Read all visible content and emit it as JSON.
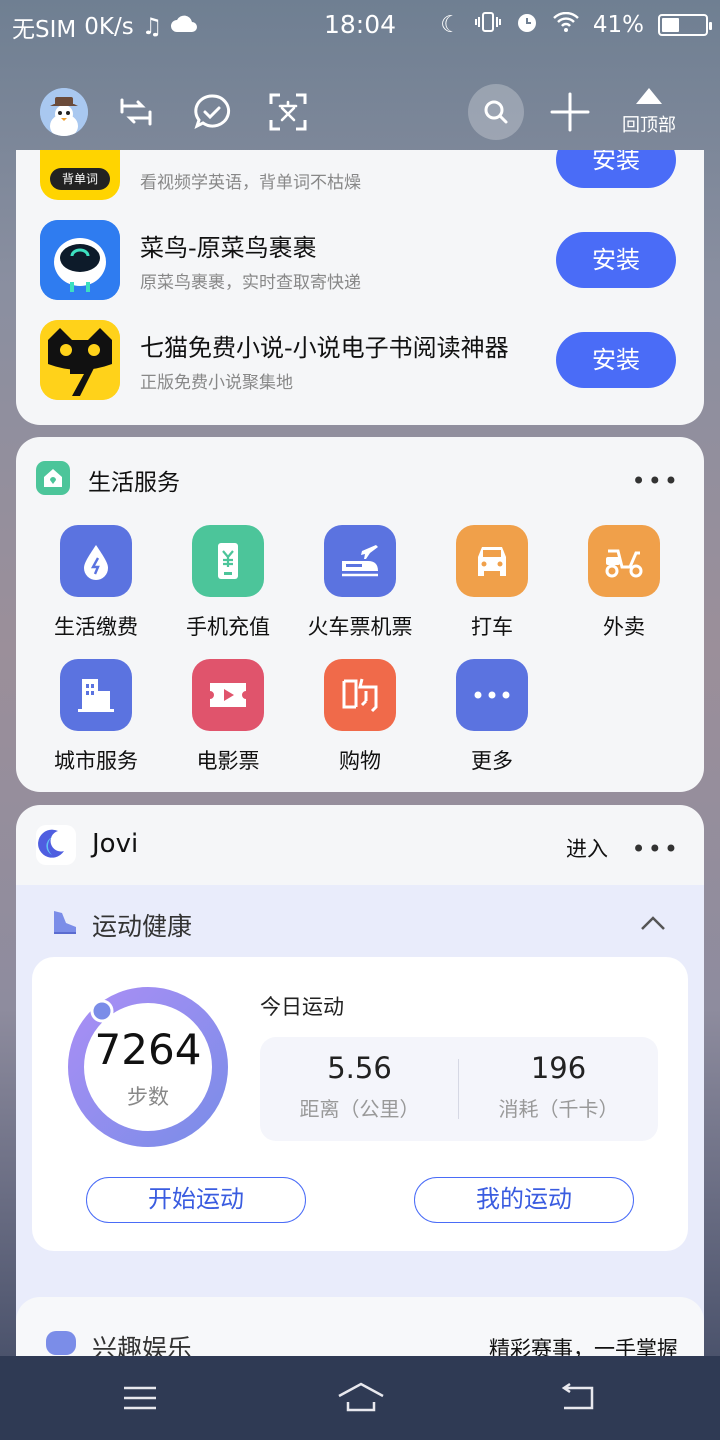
{
  "status_bar": {
    "carrier": "无SIM",
    "net_speed": "0K/s",
    "time": "18:04",
    "battery_percent": "41%",
    "battery_level": 0.41
  },
  "toolbar": {
    "back_to_top_label": "回顶部"
  },
  "apps": [
    {
      "title": "",
      "subtitle": "看视频学英语，背单词不枯燥",
      "badge": "背单词",
      "install": "安装"
    },
    {
      "title": "菜鸟-原菜鸟裹裹",
      "subtitle": "原菜鸟裹裹，实时查取寄快递",
      "install": "安装"
    },
    {
      "title": "七猫免费小说-小说电子书阅读神器",
      "subtitle": "正版免费小说聚集地",
      "install": "安装"
    }
  ],
  "life_services": {
    "title": "生活服务",
    "items": [
      {
        "label": "生活缴费",
        "icon": "water-drop-icon",
        "color": "#5b73e0"
      },
      {
        "label": "手机充值",
        "icon": "phone-yuan-icon",
        "color": "#4cc59a"
      },
      {
        "label": "火车票机票",
        "icon": "train-plane-icon",
        "color": "#5b73e0"
      },
      {
        "label": "打车",
        "icon": "car-icon",
        "color": "#f0a04a"
      },
      {
        "label": "外卖",
        "icon": "scooter-icon",
        "color": "#f0a04a"
      },
      {
        "label": "城市服务",
        "icon": "city-icon",
        "color": "#5b73e0"
      },
      {
        "label": "电影票",
        "icon": "ticket-icon",
        "color": "#e0546c"
      },
      {
        "label": "购物",
        "icon": "shopping-icon",
        "color": "#f06a4a"
      },
      {
        "label": "更多",
        "icon": "more-icon",
        "color": "#5b73e0"
      }
    ]
  },
  "jovi": {
    "title": "Jovi",
    "enter": "进入",
    "health": {
      "title": "运动健康",
      "steps": "7264",
      "steps_label": "步数",
      "today_label": "今日运动",
      "distance": "5.56",
      "distance_label": "距离（公里）",
      "calories": "196",
      "calories_label": "消耗（千卡）",
      "start_btn": "开始运动",
      "my_btn": "我的运动"
    },
    "entertainment": {
      "title": "兴趣娱乐",
      "subtitle": "精彩赛事，一手掌握"
    }
  },
  "colors": {
    "accent": "#4a6cf7"
  }
}
